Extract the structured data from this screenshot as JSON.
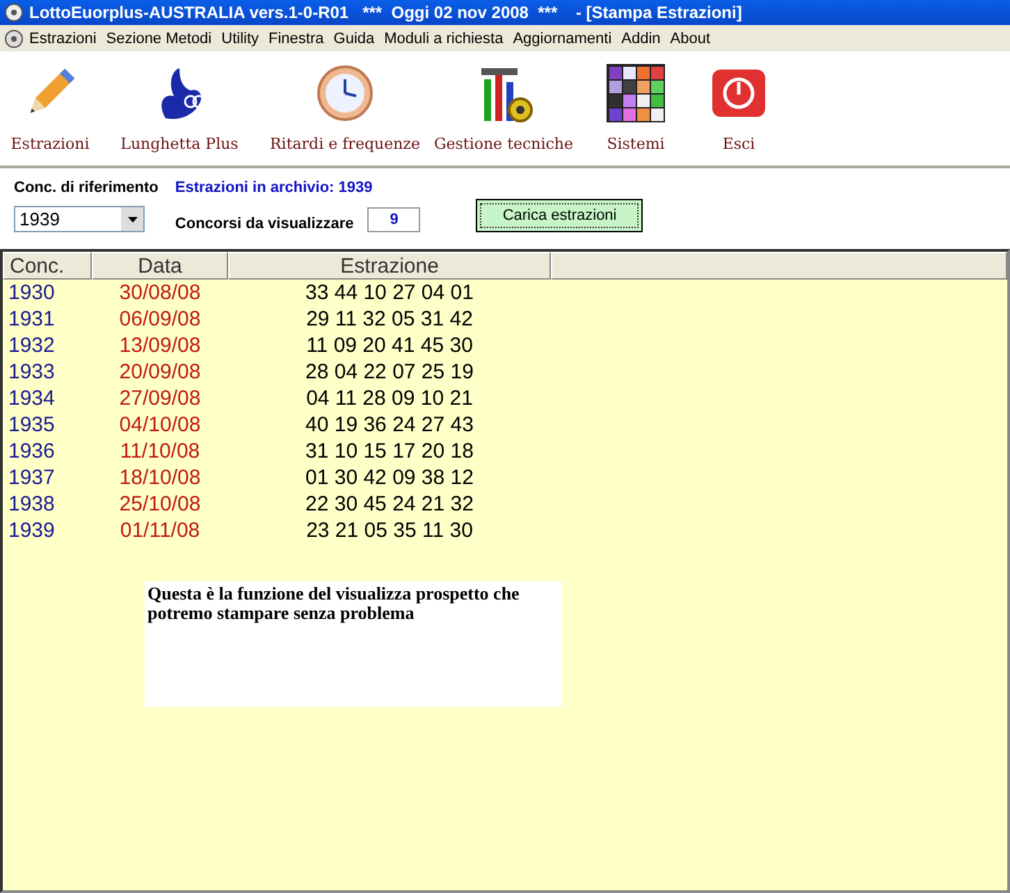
{
  "window": {
    "title": "LottoEuorplus-AUSTRALIA vers.1-0-R01   ***  Oggi 02 nov 2008  ***    - [Stampa Estrazioni]"
  },
  "menu": [
    "Estrazioni",
    "Sezione Metodi",
    "Utility",
    "Finestra",
    "Guida",
    "Moduli a richiesta",
    "Aggiornamenti",
    "Addin",
    "About"
  ],
  "toolbar": [
    {
      "kind": "pencil",
      "label": "Estrazioni"
    },
    {
      "kind": "hand",
      "label": "Lunghetta Plus"
    },
    {
      "kind": "clock",
      "label": "Ritardi e frequenze"
    },
    {
      "kind": "tools",
      "label": "Gestione tecniche"
    },
    {
      "kind": "grid",
      "label": "Sistemi"
    },
    {
      "kind": "exit",
      "label": "Esci"
    }
  ],
  "form": {
    "reference_label": "Conc. di riferimento",
    "archive_info": "Estrazioni in archivio: 1939",
    "reference_value": "1939",
    "count_label": "Concorsi da visualizzare",
    "count_value": "9",
    "load_button": "Carica estrazioni"
  },
  "table": {
    "columns": [
      "Conc.",
      "Data",
      "Estrazione"
    ],
    "rows": [
      {
        "conc": "1930",
        "data": "30/08/08",
        "estrazione": "33 44 10 27 04 01"
      },
      {
        "conc": "1931",
        "data": "06/09/08",
        "estrazione": "29 11 32 05 31 42"
      },
      {
        "conc": "1932",
        "data": "13/09/08",
        "estrazione": "11 09 20 41 45 30"
      },
      {
        "conc": "1933",
        "data": "20/09/08",
        "estrazione": "28 04 22 07 25 19"
      },
      {
        "conc": "1934",
        "data": "27/09/08",
        "estrazione": "04 11 28 09 10 21"
      },
      {
        "conc": "1935",
        "data": "04/10/08",
        "estrazione": "40 19 36 24 27 43"
      },
      {
        "conc": "1936",
        "data": "11/10/08",
        "estrazione": "31 10 15 17 20 18"
      },
      {
        "conc": "1937",
        "data": "18/10/08",
        "estrazione": "01 30 42 09 38 12"
      },
      {
        "conc": "1938",
        "data": "25/10/08",
        "estrazione": "22 30 45 24 21 32"
      },
      {
        "conc": "1939",
        "data": "01/11/08",
        "estrazione": "23 21 05 35 11 30"
      }
    ]
  },
  "note": "Questa è la funzione del visualizza prospetto che potremo stampare senza problema"
}
